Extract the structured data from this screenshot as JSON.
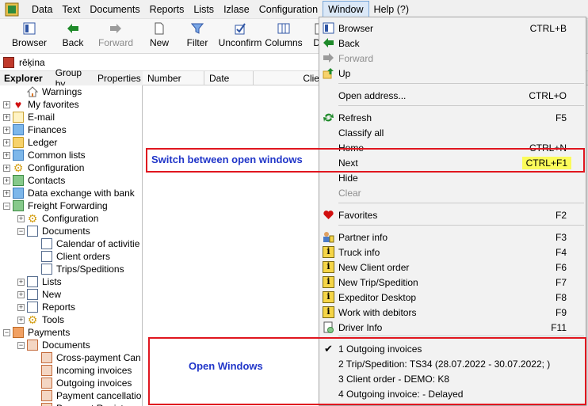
{
  "menubar": {
    "items": [
      "Data",
      "Text",
      "Documents",
      "Reports",
      "Lists",
      "Izlase",
      "Configuration",
      "Window",
      "Help (?)"
    ],
    "active": "Window"
  },
  "toolbar": {
    "buttons": [
      {
        "label": "Browser",
        "icon": "browser-icon",
        "disabled": false
      },
      {
        "label": "Back",
        "icon": "arrow-left-icon",
        "disabled": false
      },
      {
        "label": "Forward",
        "icon": "arrow-right-icon",
        "disabled": true
      },
      {
        "label": "New",
        "icon": "new-document-icon",
        "disabled": false
      },
      {
        "label": "Filter",
        "icon": "filter-icon",
        "disabled": false
      },
      {
        "label": "Unconfirm",
        "icon": "unconfirm-icon",
        "disabled": false
      },
      {
        "label": "Columns",
        "icon": "columns-icon",
        "disabled": false
      },
      {
        "label": "De",
        "icon": "delete-icon",
        "disabled": false
      }
    ]
  },
  "address": {
    "text": "rēķina"
  },
  "explorer_tabs": {
    "explorer": "Explorer",
    "group_by": "Group by",
    "properties": "Properties"
  },
  "columns": [
    "Number",
    "Date",
    "Client"
  ],
  "tree": [
    {
      "label": "Warnings",
      "icon": "home-icon",
      "indent": 1,
      "expander": ""
    },
    {
      "label": "My favorites",
      "icon": "heart-icon",
      "indent": 0,
      "expander": "+"
    },
    {
      "label": "E-mail",
      "icon": "envelope-icon",
      "indent": 0,
      "expander": "+"
    },
    {
      "label": "Finances",
      "icon": "folder-icon",
      "indent": 0,
      "expander": "+"
    },
    {
      "label": "Ledger",
      "icon": "folder-icon",
      "indent": 0,
      "expander": "+"
    },
    {
      "label": "Common lists",
      "icon": "folder-icon",
      "indent": 0,
      "expander": "+"
    },
    {
      "label": "Configuration",
      "icon": "gear-icon",
      "indent": 0,
      "expander": "+"
    },
    {
      "label": "Contacts",
      "icon": "folder-icon",
      "indent": 0,
      "expander": "+"
    },
    {
      "label": "Data exchange with bank",
      "icon": "folder-icon",
      "indent": 0,
      "expander": "+"
    },
    {
      "label": "Freight Forwarding",
      "icon": "folder-icon",
      "indent": 0,
      "expander": "−"
    },
    {
      "label": "Configuration",
      "icon": "gear-icon",
      "indent": 1,
      "expander": "+"
    },
    {
      "label": "Documents",
      "icon": "document-icon",
      "indent": 1,
      "expander": "−"
    },
    {
      "label": "Calendar of activitie",
      "icon": "document-icon",
      "indent": 2,
      "expander": ""
    },
    {
      "label": "Client orders",
      "icon": "document-icon",
      "indent": 2,
      "expander": ""
    },
    {
      "label": "Trips/Speditions",
      "icon": "document-icon",
      "indent": 2,
      "expander": ""
    },
    {
      "label": "Lists",
      "icon": "list-icon",
      "indent": 1,
      "expander": "+"
    },
    {
      "label": "New",
      "icon": "new-icon",
      "indent": 1,
      "expander": "+"
    },
    {
      "label": "Reports",
      "icon": "report-icon",
      "indent": 1,
      "expander": "+"
    },
    {
      "label": "Tools",
      "icon": "tools-icon",
      "indent": 1,
      "expander": "+"
    },
    {
      "label": "Payments",
      "icon": "folder-icon",
      "indent": 0,
      "expander": "−"
    },
    {
      "label": "Documents",
      "icon": "document-icon",
      "indent": 1,
      "expander": "−"
    },
    {
      "label": "Cross-payment Can",
      "icon": "document-icon",
      "indent": 2,
      "expander": ""
    },
    {
      "label": "Incoming invoices",
      "icon": "document-icon",
      "indent": 2,
      "expander": ""
    },
    {
      "label": "Outgoing invoices",
      "icon": "document-icon",
      "indent": 2,
      "expander": ""
    },
    {
      "label": "Payment cancellatio",
      "icon": "document-icon",
      "indent": 2,
      "expander": ""
    },
    {
      "label": "Payment Regist",
      "icon": "document-icon",
      "indent": 2,
      "expander": ""
    }
  ],
  "window_menu": {
    "items": [
      {
        "label": "Browser",
        "shortcut": "CTRL+B",
        "icon": "browser-icon",
        "disabled": false
      },
      {
        "label": "Back",
        "shortcut": "",
        "icon": "arrow-left-icon",
        "disabled": false
      },
      {
        "label": "Forward",
        "shortcut": "",
        "icon": "arrow-right-icon",
        "disabled": true
      },
      {
        "label": "Up",
        "shortcut": "",
        "icon": "up-icon",
        "disabled": false
      },
      {
        "label": "Open address...",
        "shortcut": "CTRL+O",
        "icon": "",
        "disabled": false
      },
      {
        "label": "Refresh",
        "shortcut": "F5",
        "icon": "refresh-icon",
        "disabled": false
      },
      {
        "label": "Classify all",
        "shortcut": "",
        "icon": "",
        "disabled": false
      },
      {
        "label": "Home",
        "shortcut": "CTRL+N",
        "icon": "",
        "disabled": false
      },
      {
        "label": "Next",
        "shortcut": "CTRL+F1",
        "icon": "",
        "disabled": false
      },
      {
        "label": "Hide",
        "shortcut": "",
        "icon": "",
        "disabled": false
      },
      {
        "label": "Clear",
        "shortcut": "",
        "icon": "",
        "disabled": true
      },
      {
        "label": "Favorites",
        "shortcut": "F2",
        "icon": "heart-icon",
        "disabled": false
      },
      {
        "label": "Partner info",
        "shortcut": "F3",
        "icon": "partner-icon",
        "disabled": false
      },
      {
        "label": "Truck info",
        "shortcut": "F4",
        "icon": "info-icon",
        "disabled": false
      },
      {
        "label": "New Client order",
        "shortcut": "F6",
        "icon": "info-icon",
        "disabled": false
      },
      {
        "label": "New Trip/Spedition",
        "shortcut": "F7",
        "icon": "info-icon",
        "disabled": false
      },
      {
        "label": "Expeditor Desktop",
        "shortcut": "F8",
        "icon": "info-icon",
        "disabled": false
      },
      {
        "label": "Work with debitors",
        "shortcut": "F9",
        "icon": "info-icon",
        "disabled": false
      },
      {
        "label": "Driver Info",
        "shortcut": "F11",
        "icon": "driver-icon",
        "disabled": false
      }
    ],
    "open_windows": [
      {
        "label": "1 Outgoing invoices",
        "checked": true
      },
      {
        "label": "2 Trip/Spedition: TS34  (28.07.2022 - 30.07.2022; )",
        "checked": false
      },
      {
        "label": "3 Client order - DEMO: K8",
        "checked": false
      },
      {
        "label": "4 Outgoing invoice:  - Delayed",
        "checked": false
      }
    ]
  },
  "annotations": {
    "switch_label": "Switch between open windows",
    "open_windows_label": "Open Windows",
    "highlight_color": "#e0161f",
    "text_color": "#2136c9"
  }
}
